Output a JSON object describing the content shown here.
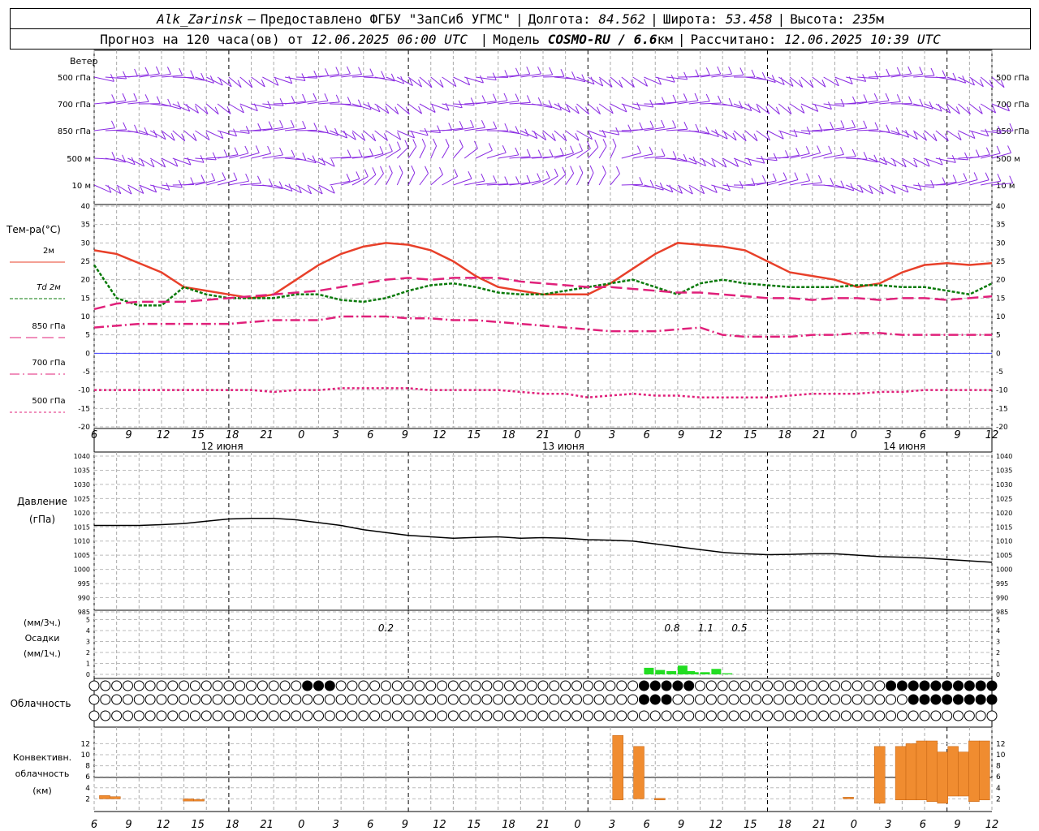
{
  "header": {
    "station": "Alk_Zarinsk",
    "dash": "–",
    "provider": "Предоставлено ФГБУ \"ЗапСиб УГМС\"",
    "lon_label": "Долгота:",
    "lon": "84.562",
    "lat_label": "Широта:",
    "lat": "53.458",
    "alt_label": "Высота:",
    "alt": "235",
    "alt_unit": "м",
    "forecast_label": "Прогноз на 120 часа(ов) от",
    "forecast_from": "12.06.2025 06:00 UTC",
    "model_label": "Модель",
    "model": "COSMO-RU / 6.6",
    "model_unit": "км",
    "calc_label": "Рассчитано:",
    "calc_time": "12.06.2025 10:39 UTC"
  },
  "wind_panel": {
    "title": "Ветер",
    "levels": [
      "500 гПа",
      "700 гПа",
      "850 гПа",
      "500 м",
      "10 м"
    ],
    "barb_color": "#8a2be2"
  },
  "temp_panel": {
    "title": "Тем-ра(°C)",
    "legend": [
      "2м",
      "Td 2м",
      "850 гПа",
      "700 гПа",
      "500 гПа"
    ],
    "yticks": [
      40,
      35,
      30,
      25,
      20,
      15,
      10,
      5,
      0,
      -5,
      -10,
      -15,
      -20
    ]
  },
  "pressure_panel": {
    "title_1": "Давление",
    "title_2": "(гПа)",
    "yticks": [
      1040,
      1035,
      1030,
      1025,
      1020,
      1015,
      1010,
      1005,
      1000,
      995,
      990,
      985
    ]
  },
  "precip_panel": {
    "title_1": "(мм/3ч.)",
    "title_2": "Осадки",
    "title_3": "(мм/1ч.)",
    "yticks": [
      5,
      4,
      3,
      2,
      1,
      0
    ],
    "labels": [
      {
        "hour": 26,
        "text": "0.2"
      },
      {
        "hour": 51.5,
        "text": "0.8"
      },
      {
        "hour": 54.5,
        "text": "1.1"
      },
      {
        "hour": 57.5,
        "text": "0.5"
      }
    ]
  },
  "cloud_panel": {
    "title": "Облачность"
  },
  "conv_panel": {
    "title_1": "Конвективн.",
    "title_2": "облачность",
    "title_3": "(км)",
    "yticks": [
      12,
      10,
      8,
      6,
      4,
      2
    ]
  },
  "time_axis": {
    "hour_labels": [
      "6",
      "9",
      "12",
      "15",
      "18",
      "21",
      "0",
      "3",
      "6",
      "9",
      "12",
      "15",
      "18",
      "21",
      "0",
      "3",
      "6",
      "9",
      "12",
      "15",
      "18",
      "21",
      "0",
      "3",
      "6",
      "9",
      "12"
    ],
    "day_labels": [
      "12 июня",
      "13 июня",
      "14 июня"
    ]
  },
  "chart_data": [
    {
      "type": "line",
      "title": "Температура",
      "x_unit": "hours since 12.06 06 UTC",
      "x": [
        0,
        3,
        6,
        9,
        12,
        15,
        18,
        21,
        24,
        27,
        30,
        33,
        36,
        39,
        42,
        45,
        48,
        51,
        54,
        57,
        60,
        63,
        66,
        69,
        72,
        75,
        78,
        81,
        84,
        87,
        90,
        93,
        96,
        99,
        102,
        105,
        108,
        111,
        114,
        117,
        120
      ],
      "ylim": [
        -20,
        40
      ],
      "series": [
        {
          "name": "2м",
          "color": "#e8402a",
          "dash": "",
          "values": [
            28,
            27,
            24.5,
            22,
            18,
            17,
            16,
            15,
            16,
            20,
            24,
            27,
            29,
            30,
            29.5,
            28,
            25,
            21,
            18,
            17,
            16,
            16,
            16,
            19,
            23,
            27,
            30,
            29.5,
            29,
            28,
            25,
            22,
            21,
            20,
            18,
            19,
            22,
            24,
            24.5,
            24,
            24.5
          ]
        },
        {
          "name": "Td 2м",
          "color": "#0a7a0a",
          "dash": "4,2",
          "values": [
            24,
            15,
            13,
            13,
            18,
            16,
            15,
            15,
            15,
            16,
            16,
            14.5,
            14,
            15,
            17,
            18.5,
            19,
            18,
            16.5,
            16,
            16,
            17,
            18,
            19,
            20,
            18,
            16,
            19,
            20,
            19,
            18.5,
            18,
            18,
            18,
            18.5,
            18.5,
            18,
            18,
            17,
            16,
            19
          ]
        },
        {
          "name": "850 гПа",
          "color": "#e0207a",
          "dash": "14,6",
          "values": [
            12,
            13.5,
            14,
            14,
            14,
            14.5,
            15,
            15.5,
            16,
            16.5,
            17,
            18,
            19,
            20,
            20.5,
            20,
            20.5,
            20.5,
            20.5,
            19.5,
            19,
            18.5,
            18,
            18,
            17.5,
            17,
            16.5,
            16.5,
            16,
            15.5,
            15,
            15,
            14.5,
            15,
            15,
            14.5,
            15,
            15,
            14.5,
            15,
            15.5
          ]
        },
        {
          "name": "700 гПа",
          "color": "#e0207a",
          "dash": "12,4,2,4",
          "values": [
            7,
            7.5,
            8,
            8,
            8,
            8,
            8,
            8.5,
            9,
            9,
            9,
            10,
            10,
            10,
            9.5,
            9.5,
            9,
            9,
            8.5,
            8,
            7.5,
            7,
            6.5,
            6,
            6,
            6,
            6.5,
            7,
            5,
            4.5,
            4.5,
            4.5,
            5,
            5,
            5.5,
            5.5,
            5,
            5,
            5,
            5,
            5
          ]
        },
        {
          "name": "500 гПа",
          "color": "#e0207a",
          "dash": "3,3",
          "values": [
            -10,
            -10,
            -10,
            -10,
            -10,
            -10,
            -10,
            -10,
            -10.5,
            -10,
            -10,
            -9.5,
            -9.5,
            -9.5,
            -9.5,
            -10,
            -10,
            -10,
            -10,
            -10.5,
            -11,
            -11,
            -12,
            -11.5,
            -11,
            -11.5,
            -11.5,
            -12,
            -12,
            -12,
            -12,
            -11.5,
            -11,
            -11,
            -11,
            -10.5,
            -10.5,
            -10,
            -10,
            -10,
            -10
          ]
        }
      ]
    },
    {
      "type": "line",
      "title": "Давление",
      "x": [
        0,
        3,
        6,
        9,
        12,
        15,
        18,
        21,
        24,
        27,
        30,
        33,
        36,
        39,
        42,
        45,
        48,
        51,
        54,
        57,
        60,
        63,
        66,
        69,
        72,
        75,
        78,
        81,
        84,
        87,
        90,
        93,
        96,
        99,
        102,
        105,
        108,
        111,
        114,
        117,
        120
      ],
      "ylim": [
        985,
        1040
      ],
      "series": [
        {
          "name": "Давление",
          "color": "#000000",
          "values": [
            1015.5,
            1015.5,
            1015.5,
            1015.8,
            1016.2,
            1017,
            1017.8,
            1018,
            1018,
            1017.5,
            1016.5,
            1015.5,
            1014,
            1013,
            1012,
            1011.5,
            1011,
            1011.3,
            1011.5,
            1011,
            1011.2,
            1011,
            1010.5,
            1010.3,
            1010,
            1009,
            1008,
            1007,
            1006,
            1005.5,
            1005.2,
            1005.3,
            1005.5,
            1005.5,
            1005,
            1004.5,
            1004.3,
            1004,
            1003.5,
            1003,
            1002.5
          ]
        }
      ]
    },
    {
      "type": "bar",
      "title": "Осадки (мм/1ч.)",
      "x": [
        49,
        50,
        51,
        52,
        53,
        54,
        55,
        56
      ],
      "ylim": [
        0,
        5
      ],
      "values": [
        0.6,
        0.4,
        0.3,
        0.8,
        0.2,
        0.2,
        0.5,
        0.1
      ]
    },
    {
      "type": "bar",
      "title": "Конвективн. облачность (км)",
      "bars": [
        {
          "hour": 0.5,
          "bottom": 2,
          "top": 2.6
        },
        {
          "hour": 1.5,
          "bottom": 2,
          "top": 2.4
        },
        {
          "hour": 8.5,
          "bottom": 1.6,
          "top": 2
        },
        {
          "hour": 9.5,
          "bottom": 1.6,
          "top": 1.9
        },
        {
          "hour": 49.5,
          "bottom": 1.8,
          "top": 13.5
        },
        {
          "hour": 51.5,
          "bottom": 2,
          "top": 11.5
        },
        {
          "hour": 53.5,
          "bottom": 1.8,
          "top": 2.1
        },
        {
          "hour": 71.5,
          "bottom": 2,
          "top": 2.3
        },
        {
          "hour": 74.5,
          "bottom": 1.2,
          "top": 11.5
        },
        {
          "hour": 76.5,
          "bottom": 1.8,
          "top": 11.5
        },
        {
          "hour": 77.5,
          "bottom": 1.8,
          "top": 12
        },
        {
          "hour": 78.5,
          "bottom": 1.8,
          "top": 12.5
        },
        {
          "hour": 79.5,
          "bottom": 1.5,
          "top": 12.5
        },
        {
          "hour": 80.5,
          "bottom": 1.2,
          "top": 10.5
        },
        {
          "hour": 81.5,
          "bottom": 2.5,
          "top": 11.5
        },
        {
          "hour": 82.5,
          "bottom": 2.5,
          "top": 10.5
        },
        {
          "hour": 83.5,
          "bottom": 1.5,
          "top": 12.5
        },
        {
          "hour": 84.5,
          "bottom": 1.8,
          "top": 12.5
        }
      ],
      "ylim": [
        0,
        14
      ]
    }
  ]
}
